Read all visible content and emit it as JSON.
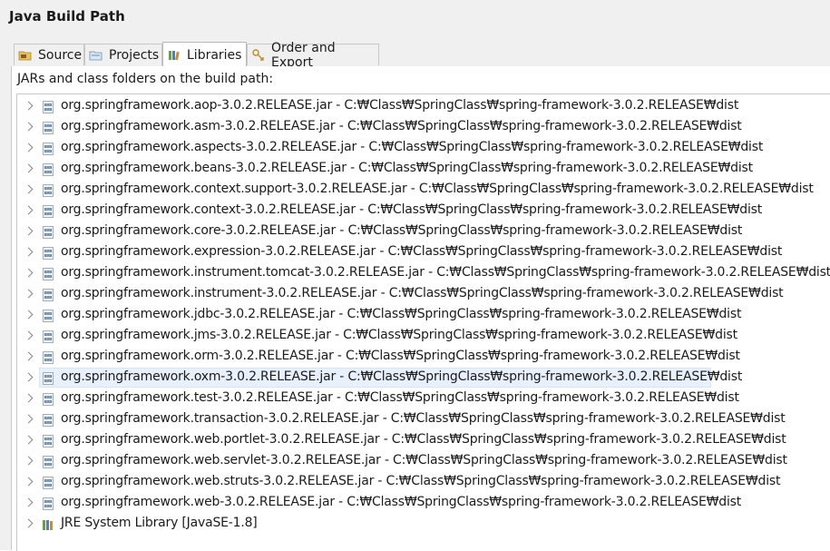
{
  "window": {
    "title": "Java Build Path"
  },
  "tabs": [
    {
      "label": "Source",
      "icon": "source-folder-icon",
      "active": false
    },
    {
      "label": "Projects",
      "icon": "projects-icon",
      "active": false
    },
    {
      "label": "Libraries",
      "icon": "libraries-icon",
      "active": true
    },
    {
      "label": "Order and Export",
      "icon": "order-export-icon",
      "active": false
    }
  ],
  "libraries": {
    "subtitle": "JARs and class folders on the build path:",
    "items": [
      "org.springframework.aop-3.0.2.RELEASE.jar - C:₩Class₩SpringClass₩spring-framework-3.0.2.RELEASE₩dist",
      "org.springframework.asm-3.0.2.RELEASE.jar - C:₩Class₩SpringClass₩spring-framework-3.0.2.RELEASE₩dist",
      "org.springframework.aspects-3.0.2.RELEASE.jar - C:₩Class₩SpringClass₩spring-framework-3.0.2.RELEASE₩dist",
      "org.springframework.beans-3.0.2.RELEASE.jar - C:₩Class₩SpringClass₩spring-framework-3.0.2.RELEASE₩dist",
      "org.springframework.context.support-3.0.2.RELEASE.jar - C:₩Class₩SpringClass₩spring-framework-3.0.2.RELEASE₩dist",
      "org.springframework.context-3.0.2.RELEASE.jar - C:₩Class₩SpringClass₩spring-framework-3.0.2.RELEASE₩dist",
      "org.springframework.core-3.0.2.RELEASE.jar - C:₩Class₩SpringClass₩spring-framework-3.0.2.RELEASE₩dist",
      "org.springframework.expression-3.0.2.RELEASE.jar - C:₩Class₩SpringClass₩spring-framework-3.0.2.RELEASE₩dist",
      "org.springframework.instrument.tomcat-3.0.2.RELEASE.jar - C:₩Class₩SpringClass₩spring-framework-3.0.2.RELEASE₩dist",
      "org.springframework.instrument-3.0.2.RELEASE.jar - C:₩Class₩SpringClass₩spring-framework-3.0.2.RELEASE₩dist",
      "org.springframework.jdbc-3.0.2.RELEASE.jar - C:₩Class₩SpringClass₩spring-framework-3.0.2.RELEASE₩dist",
      "org.springframework.jms-3.0.2.RELEASE.jar - C:₩Class₩SpringClass₩spring-framework-3.0.2.RELEASE₩dist",
      "org.springframework.orm-3.0.2.RELEASE.jar - C:₩Class₩SpringClass₩spring-framework-3.0.2.RELEASE₩dist",
      "org.springframework.oxm-3.0.2.RELEASE.jar - C:₩Class₩SpringClass₩spring-framework-3.0.2.RELEASE₩dist",
      "org.springframework.test-3.0.2.RELEASE.jar - C:₩Class₩SpringClass₩spring-framework-3.0.2.RELEASE₩dist",
      "org.springframework.transaction-3.0.2.RELEASE.jar - C:₩Class₩SpringClass₩spring-framework-3.0.2.RELEASE₩dist",
      "org.springframework.web.portlet-3.0.2.RELEASE.jar - C:₩Class₩SpringClass₩spring-framework-3.0.2.RELEASE₩dist",
      "org.springframework.web.servlet-3.0.2.RELEASE.jar - C:₩Class₩SpringClass₩spring-framework-3.0.2.RELEASE₩dist",
      "org.springframework.web.struts-3.0.2.RELEASE.jar - C:₩Class₩SpringClass₩spring-framework-3.0.2.RELEASE₩dist",
      "org.springframework.web-3.0.2.RELEASE.jar - C:₩Class₩SpringClass₩spring-framework-3.0.2.RELEASE₩dist"
    ],
    "jre": "JRE System Library [JavaSE-1.8]",
    "selected_index": 13,
    "item_icon": "jar-icon",
    "jre_icon": "library-icon"
  },
  "colors": {
    "selection": "#e8f1fb",
    "jar_icon": "#5b7fa6"
  }
}
